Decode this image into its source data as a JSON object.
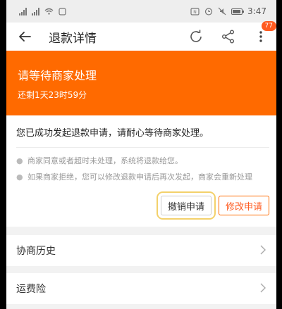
{
  "status_bar": {
    "time": "3:47"
  },
  "app_bar": {
    "title": "退款详情",
    "badge_count": "77"
  },
  "banner": {
    "title": "请等待商家处理",
    "countdown": "还剩1天23时59分",
    "color": "#ff6a00"
  },
  "card": {
    "message": "您已成功发起退款申请，请耐心等待商家处理。",
    "notes": [
      "商家同意或者超时未处理，系统将退款给您。",
      "如果商家拒绝，您可以修改退款申请后再次发起，商家会重新处理"
    ],
    "cancel_label": "撤销申请",
    "modify_label": "修改申请"
  },
  "rows": [
    {
      "label": "协商历史"
    },
    {
      "label": "运费险"
    }
  ]
}
